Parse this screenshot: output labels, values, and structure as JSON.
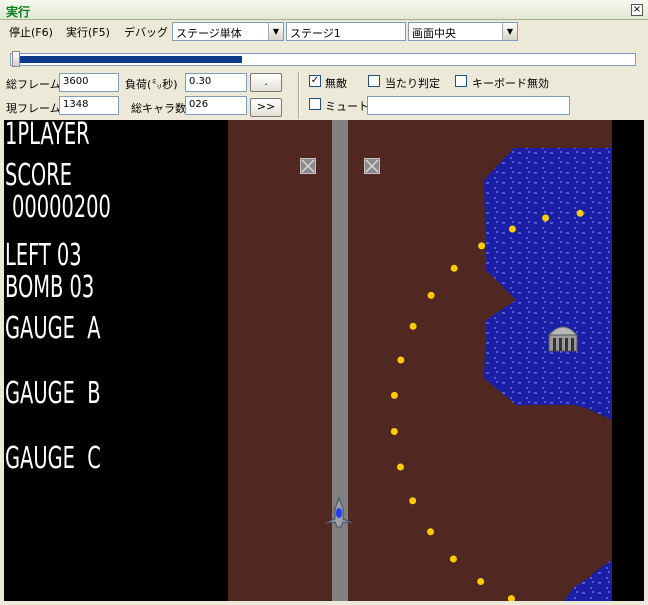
{
  "window": {
    "title": "実行",
    "close_glyph": "×"
  },
  "menu": {
    "stop": "停止(F6)",
    "run": "実行(F5)",
    "debug": "デバッグ",
    "mode_select": "ステージ単体",
    "stage_field": "ステージ1",
    "view_select": "画面中央"
  },
  "seek": {
    "progress": 0.37
  },
  "stats": {
    "total_frames_label": "総フレーム",
    "total_frames": "3600",
    "current_frame_label": "現フレーム",
    "current_frame": "1348",
    "load_label": "負荷(㍉秒)",
    "load": "0.30",
    "char_count_label": "総キャラ数",
    "char_count": "026",
    "step_button": ".",
    "ff_button": ">>"
  },
  "options": {
    "invincible": {
      "label": "無敵",
      "checked": true,
      "glyph": "✓"
    },
    "hit_check": {
      "label": "当たり判定",
      "checked": false
    },
    "keyboard_off": {
      "label": "キーボード無効",
      "checked": false
    },
    "mute": {
      "label": "ミュート",
      "checked": false
    },
    "message": ""
  },
  "hud": {
    "player": "1PLAYER",
    "score_label": "SCORE",
    "score": "00000200",
    "left": "LEFT 03",
    "bomb": "BOMB 03",
    "gauge_a": "GAUGE  A",
    "gauge_b": "GAUGE  B",
    "gauge_c": "GAUGE  C"
  },
  "colors": {
    "field": "#512821",
    "water": "#1b1fa6",
    "road": "#808080",
    "bullet": "#ffcc00",
    "title": "#0a7d1c"
  }
}
